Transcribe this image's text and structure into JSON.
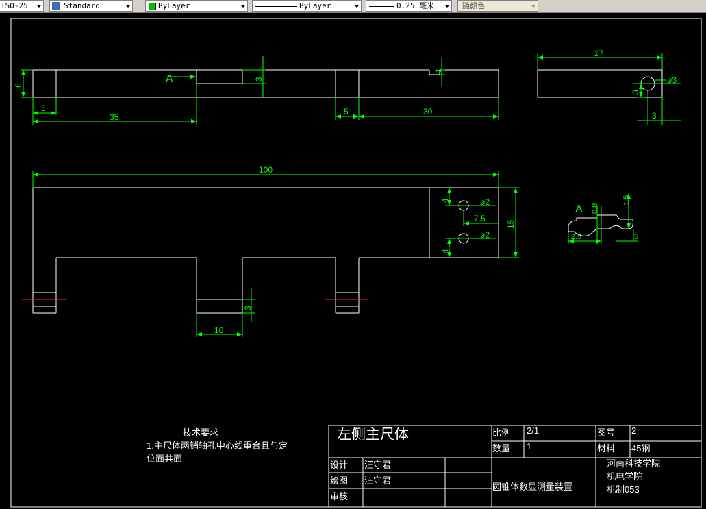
{
  "toolbar": {
    "dimstyle": "ISO-25",
    "textstyle": "Standard",
    "layer_color": "ByLayer",
    "linetype": "ByLayer",
    "lineweight": "0.25 毫米",
    "plot_color": "随颜色"
  },
  "drawing": {
    "dims": {
      "d6": "6",
      "d5a": "5",
      "d35": "35",
      "d3a": "3",
      "d5b": "5",
      "d30": "30",
      "d1": "1",
      "d27": "27",
      "dphi3": "ø3",
      "d3b": "3",
      "d3c": "3",
      "d100": "100",
      "d4a": "4",
      "dphi2a": "ø2",
      "d75": "7.5",
      "d15": "15",
      "d4b": "4",
      "dphi2b": "ø2",
      "d3d": "3",
      "d10": "10",
      "d08": "0.8",
      "d15b": "1.5",
      "d25": "2.5",
      "d5c": "5"
    },
    "view_label_a1": "A",
    "view_label_a2": "A",
    "notes": {
      "title": "技术要求",
      "line1": "1.主尺体两销轴孔中心线重合且与定",
      "line2": "位面共面"
    },
    "title_block": {
      "part_name": "左侧主尺体",
      "scale_label": "比例",
      "scale_value": "2/1",
      "drawing_no_label": "图号",
      "drawing_no_value": "2",
      "qty_label": "数量",
      "qty_value": "1",
      "material_label": "材料",
      "material_value": "45钢",
      "design_label": "设计",
      "design_value": "汪守君",
      "drawn_label": "绘图",
      "drawn_value": "汪守君",
      "check_label": "审核",
      "project": "圆锥体数显测量装置",
      "school1": "河南科技学院",
      "school2": "机电学院",
      "school3": "机制053"
    }
  }
}
